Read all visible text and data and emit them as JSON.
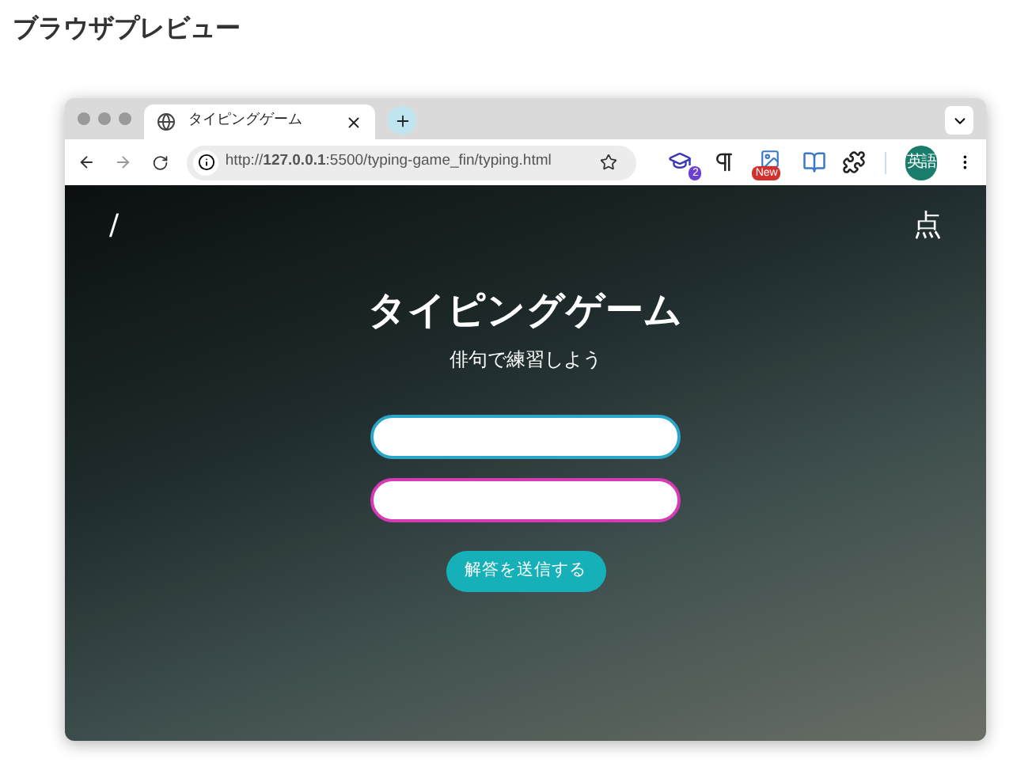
{
  "page_title": "ブラウザプレビュー",
  "browser": {
    "tabs": [
      {
        "title": "タイピングゲーム",
        "selected": true
      }
    ],
    "url": "http://**127.0.0.1**:5500/typing-game_fin/typing.html",
    "extensions": [
      {
        "kind": "cap",
        "badge": "2"
      },
      {
        "kind": "pilcrow"
      },
      {
        "kind": "new",
        "badge": "New"
      },
      {
        "kind": "book"
      },
      {
        "kind": "puzzle"
      }
    ],
    "profile": "英語"
  },
  "page": {
    "left_mark": "/",
    "score": "点",
    "title": "タイピングゲーム",
    "subtitle": "俳句で練習しよう",
    "fields": [
      {
        "color": "#2aa6c9"
      },
      {
        "color": "#d63ab5"
      }
    ],
    "submit": "解答を送信する"
  }
}
